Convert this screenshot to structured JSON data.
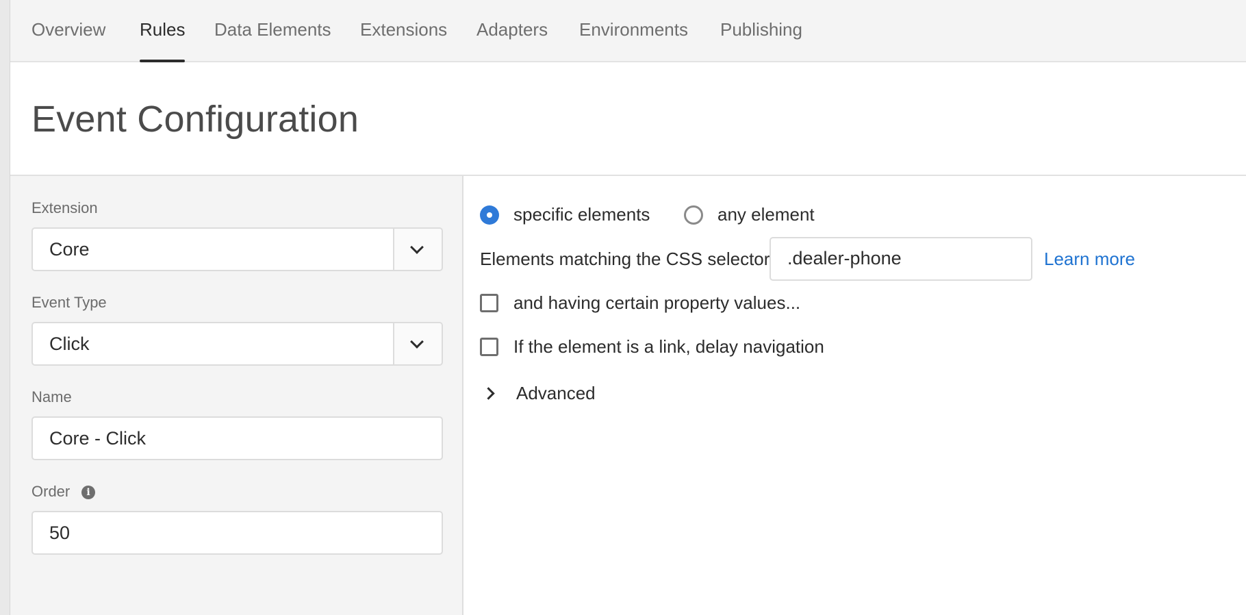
{
  "nav": {
    "tabs": [
      {
        "label": "Overview"
      },
      {
        "label": "Rules"
      },
      {
        "label": "Data Elements"
      },
      {
        "label": "Extensions"
      },
      {
        "label": "Adapters"
      },
      {
        "label": "Environments"
      },
      {
        "label": "Publishing"
      }
    ],
    "active_tab": "Rules"
  },
  "header": {
    "title": "Event Configuration"
  },
  "sidebar": {
    "extension": {
      "label": "Extension",
      "value": "Core"
    },
    "event_type": {
      "label": "Event Type",
      "value": "Click"
    },
    "name": {
      "label": "Name",
      "value": "Core - Click"
    },
    "order": {
      "label": "Order",
      "value": "50",
      "info_icon": "info-icon"
    }
  },
  "main": {
    "radios": [
      {
        "label": "specific elements",
        "checked": true
      },
      {
        "label": "any element",
        "checked": false
      }
    ],
    "css_selector": {
      "label": "Elements matching the CSS selector",
      "value": ".dealer-phone",
      "help_link": "Learn more"
    },
    "checkboxes": [
      {
        "label": "and having certain property values...",
        "checked": false
      },
      {
        "label": "If the element is a link, delay navigation",
        "checked": false
      }
    ],
    "advanced": {
      "label": "Advanced",
      "expanded": false
    }
  },
  "colors": {
    "accent": "#2f7ad8",
    "link": "#1f73d1",
    "sidebar_bg": "#f4f4f4",
    "nav_bg": "#f4f4f4"
  }
}
